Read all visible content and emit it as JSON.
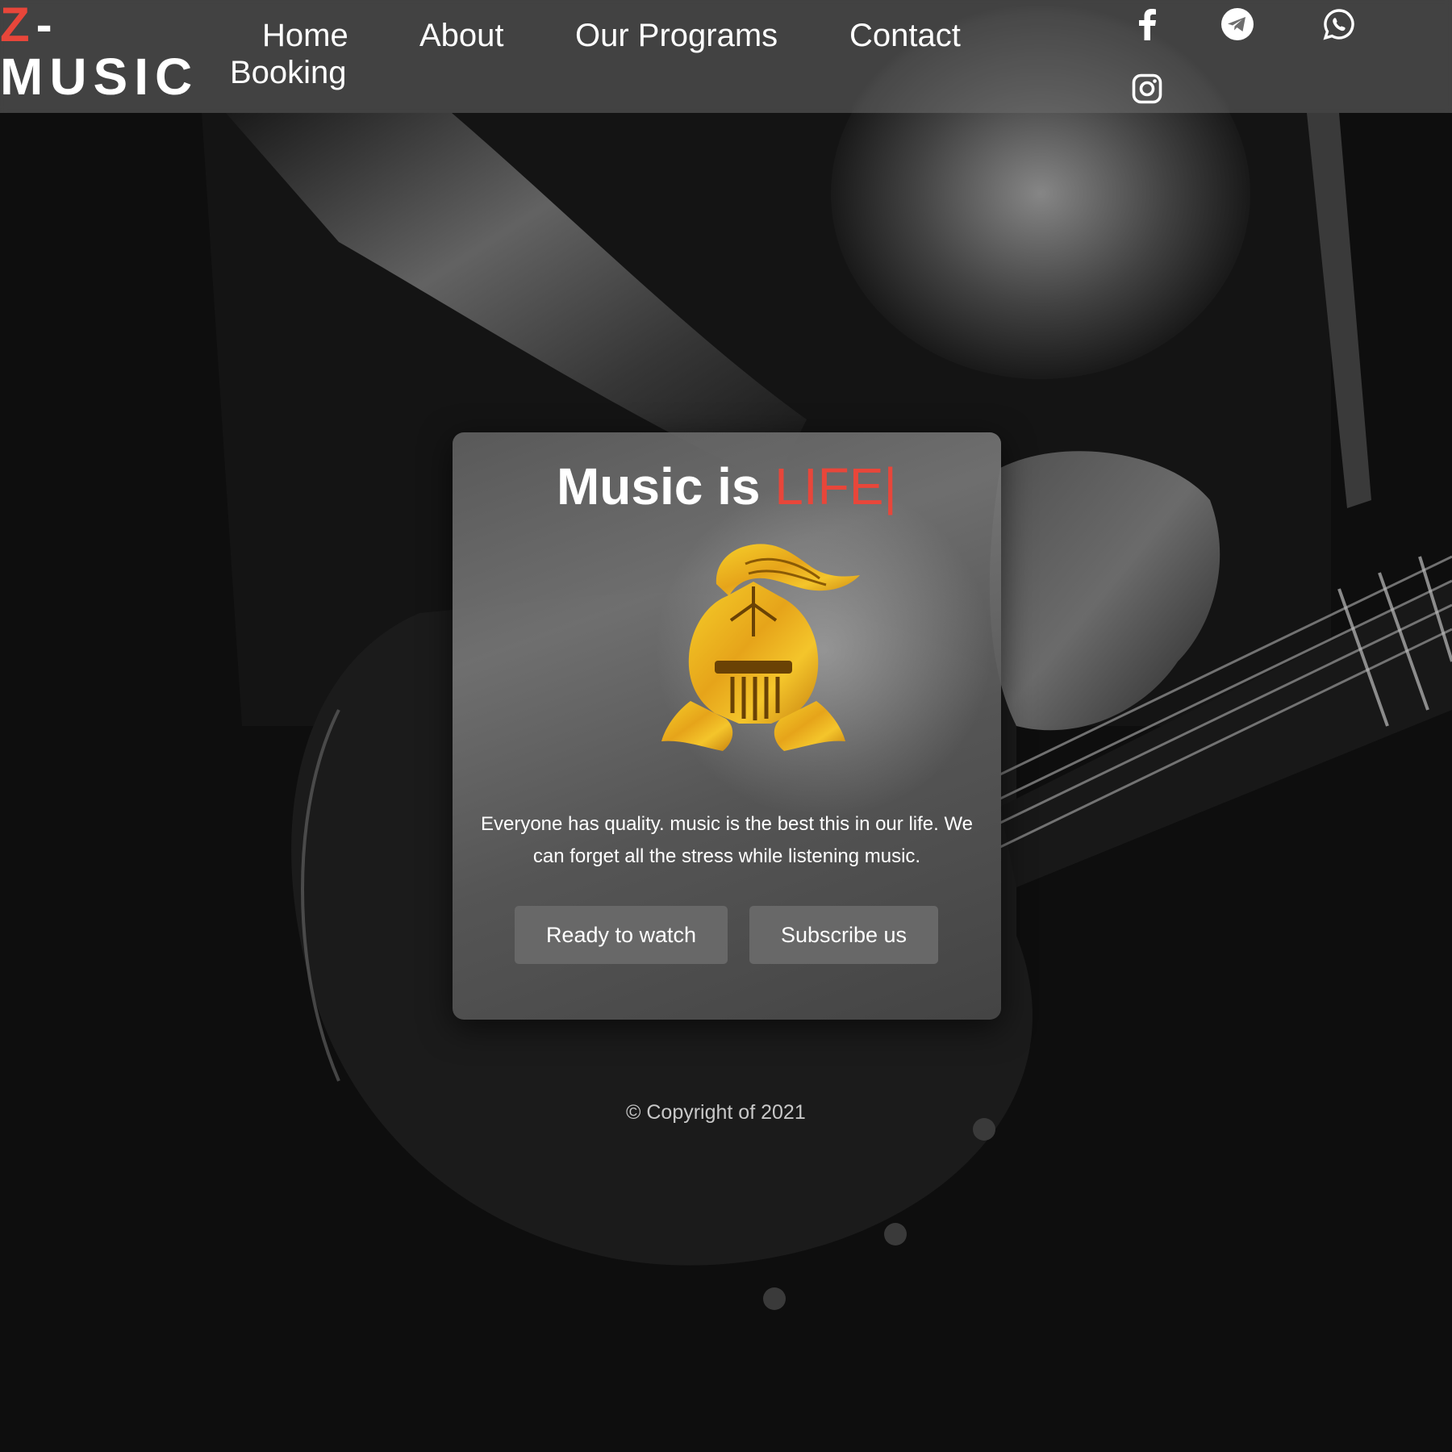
{
  "brand": {
    "logo_letter": "Z",
    "logo_dash": "-",
    "logo_word": "MUSIC",
    "accent_color": "#e8463a"
  },
  "nav": {
    "home": "Home",
    "about": "About",
    "programs": "Our Programs",
    "contact": "Contact",
    "booking": "Booking"
  },
  "social": [
    "facebook-icon",
    "telegram-icon",
    "whatsapp-icon",
    "instagram-icon"
  ],
  "hero": {
    "title_prefix": "Music is",
    "title_accent": "LIFE",
    "cursor": "|",
    "description": "Everyone has quality. music is the best this in our life. We can forget all the stress while listening music.",
    "watch_button": "Ready to watch",
    "subscribe_button": "Subscribe us"
  },
  "footer": {
    "copyright": "© Copyright of 2021"
  }
}
